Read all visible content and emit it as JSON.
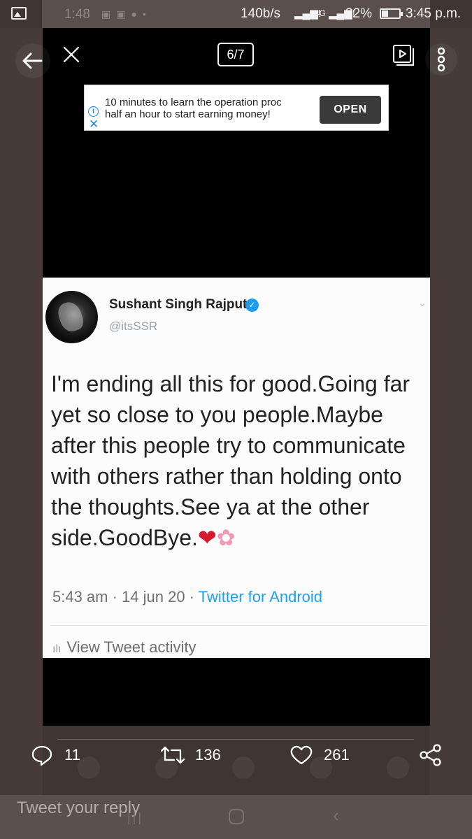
{
  "status_bar": {
    "ghost_time": "1:48",
    "network_speed": "140b/s",
    "network_type": "4G",
    "battery": "32%",
    "time": "3:45 p.m."
  },
  "nav": {
    "counter": "6/7"
  },
  "ad": {
    "text_line1": "10 minutes to learn the operation proc",
    "text_line2": "half an hour to start earning money!",
    "button": "OPEN"
  },
  "tweet": {
    "name": "Sushant Singh Rajput",
    "handle": "@itsSSR",
    "body": "I'm ending all this for good.Going far yet so close to you people.Maybe after this people try to communicate with others rather than holding onto the thoughts.See ya at the other side.GoodBye.",
    "time_date": "5:43 am · 14 jun 20 · ",
    "source": "Twitter for Android",
    "activity": "View Tweet activity"
  },
  "actions": {
    "replies": "11",
    "retweets": "136",
    "likes": "261"
  },
  "reply_bar": {
    "placeholder": "Tweet your reply"
  },
  "colors": {
    "background": "#3f3532",
    "viewer": "#000000",
    "link_blue": "#1da1f2",
    "heart_red": "#d7192e"
  }
}
